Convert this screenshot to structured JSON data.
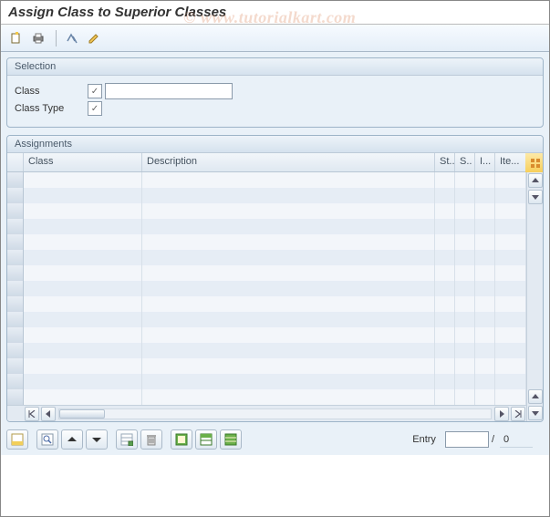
{
  "title": "Assign Class to Superior Classes",
  "watermark": "©  www.tutorialkart.com",
  "toolbar": {
    "copy_icon": "copy-icon",
    "print_icon": "print-icon",
    "edit_icon": "edit-icon",
    "pencil_icon": "pencil-icon"
  },
  "selection": {
    "panel_title": "Selection",
    "class_label": "Class",
    "class_value": "",
    "class_type_label": "Class Type",
    "class_type_value": ""
  },
  "assignments": {
    "panel_title": "Assignments",
    "columns": {
      "class": "Class",
      "description": "Description",
      "status": "St...",
      "s": "S..",
      "i": "I...",
      "item": "Ite..."
    },
    "rows": [
      {},
      {},
      {},
      {},
      {},
      {},
      {},
      {},
      {},
      {},
      {},
      {},
      {},
      {},
      {}
    ]
  },
  "footer": {
    "entry_label": "Entry",
    "entry_value": "",
    "entry_total": "0"
  },
  "colors": {
    "panel_bg": "#e9f1f8",
    "header_grad_a": "#edf3f9",
    "header_grad_b": "#d5e2ee",
    "config_btn": "#f7cf5a"
  }
}
